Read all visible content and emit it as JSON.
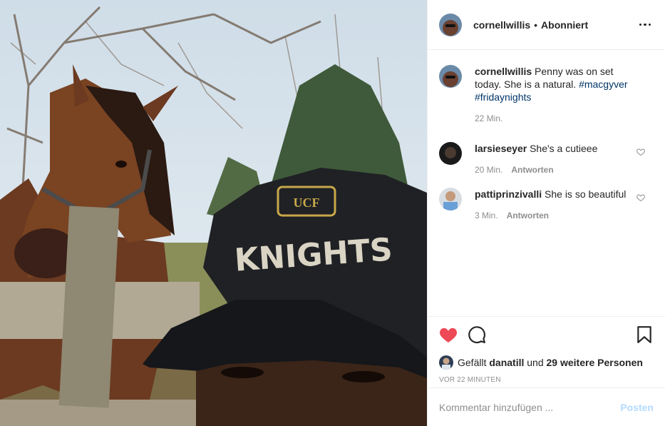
{
  "post": {
    "author": "cornellwillis",
    "follow_status": "Abonniert",
    "separator": "•"
  },
  "caption": {
    "username": "cornellwillis",
    "text": "Penny was on set today. She is a natural.",
    "hashtags": [
      "#macgyver",
      "#fridaynights"
    ],
    "time": "22 Min."
  },
  "comments": [
    {
      "username": "larsieseyer",
      "text": "She's a cutieee",
      "time": "20 Min.",
      "reply_label": "Antworten"
    },
    {
      "username": "pattiprinzivalli",
      "text": "She is so beautiful",
      "time": "3 Min.",
      "reply_label": "Antworten"
    }
  ],
  "likes": {
    "prefix": "Gefällt",
    "user": "danatill",
    "connector": "und",
    "others": "29 weitere Personen"
  },
  "timestamp": "VOR 22 MINUTEN",
  "add_comment": {
    "placeholder": "Kommentar hinzufügen ...",
    "post_label": "Posten"
  },
  "icons": {
    "like": "heart-filled-icon",
    "comment": "comment-bubble-icon",
    "save": "bookmark-icon",
    "more": "more-options-icon"
  },
  "colors": {
    "like_red": "#ed4956",
    "hashtag_blue": "#003569",
    "muted": "#8e8e8e",
    "post_button_disabled": "#b3dbff"
  }
}
